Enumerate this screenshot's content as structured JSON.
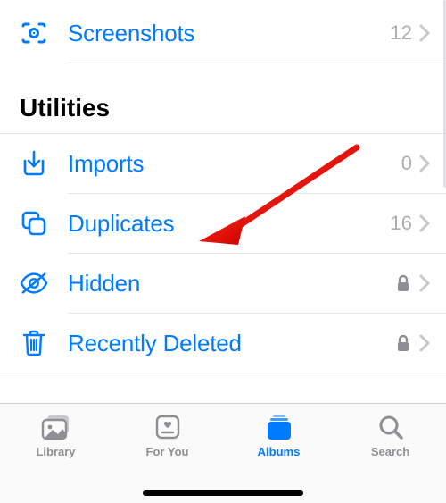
{
  "colors": {
    "accent": "#007aff",
    "muted": "#8e8e93",
    "chevron": "#c7c7cc"
  },
  "top_row": {
    "label": "Screenshots",
    "count": "12"
  },
  "section_header": "Utilities",
  "utilities": [
    {
      "id": "imports",
      "label": "Imports",
      "count": "0",
      "locked": false
    },
    {
      "id": "duplicates",
      "label": "Duplicates",
      "count": "16",
      "locked": false
    },
    {
      "id": "hidden",
      "label": "Hidden",
      "count": "",
      "locked": true
    },
    {
      "id": "recently-deleted",
      "label": "Recently Deleted",
      "count": "",
      "locked": true
    }
  ],
  "tabs": {
    "library": "Library",
    "for_you": "For You",
    "albums": "Albums",
    "search": "Search"
  }
}
